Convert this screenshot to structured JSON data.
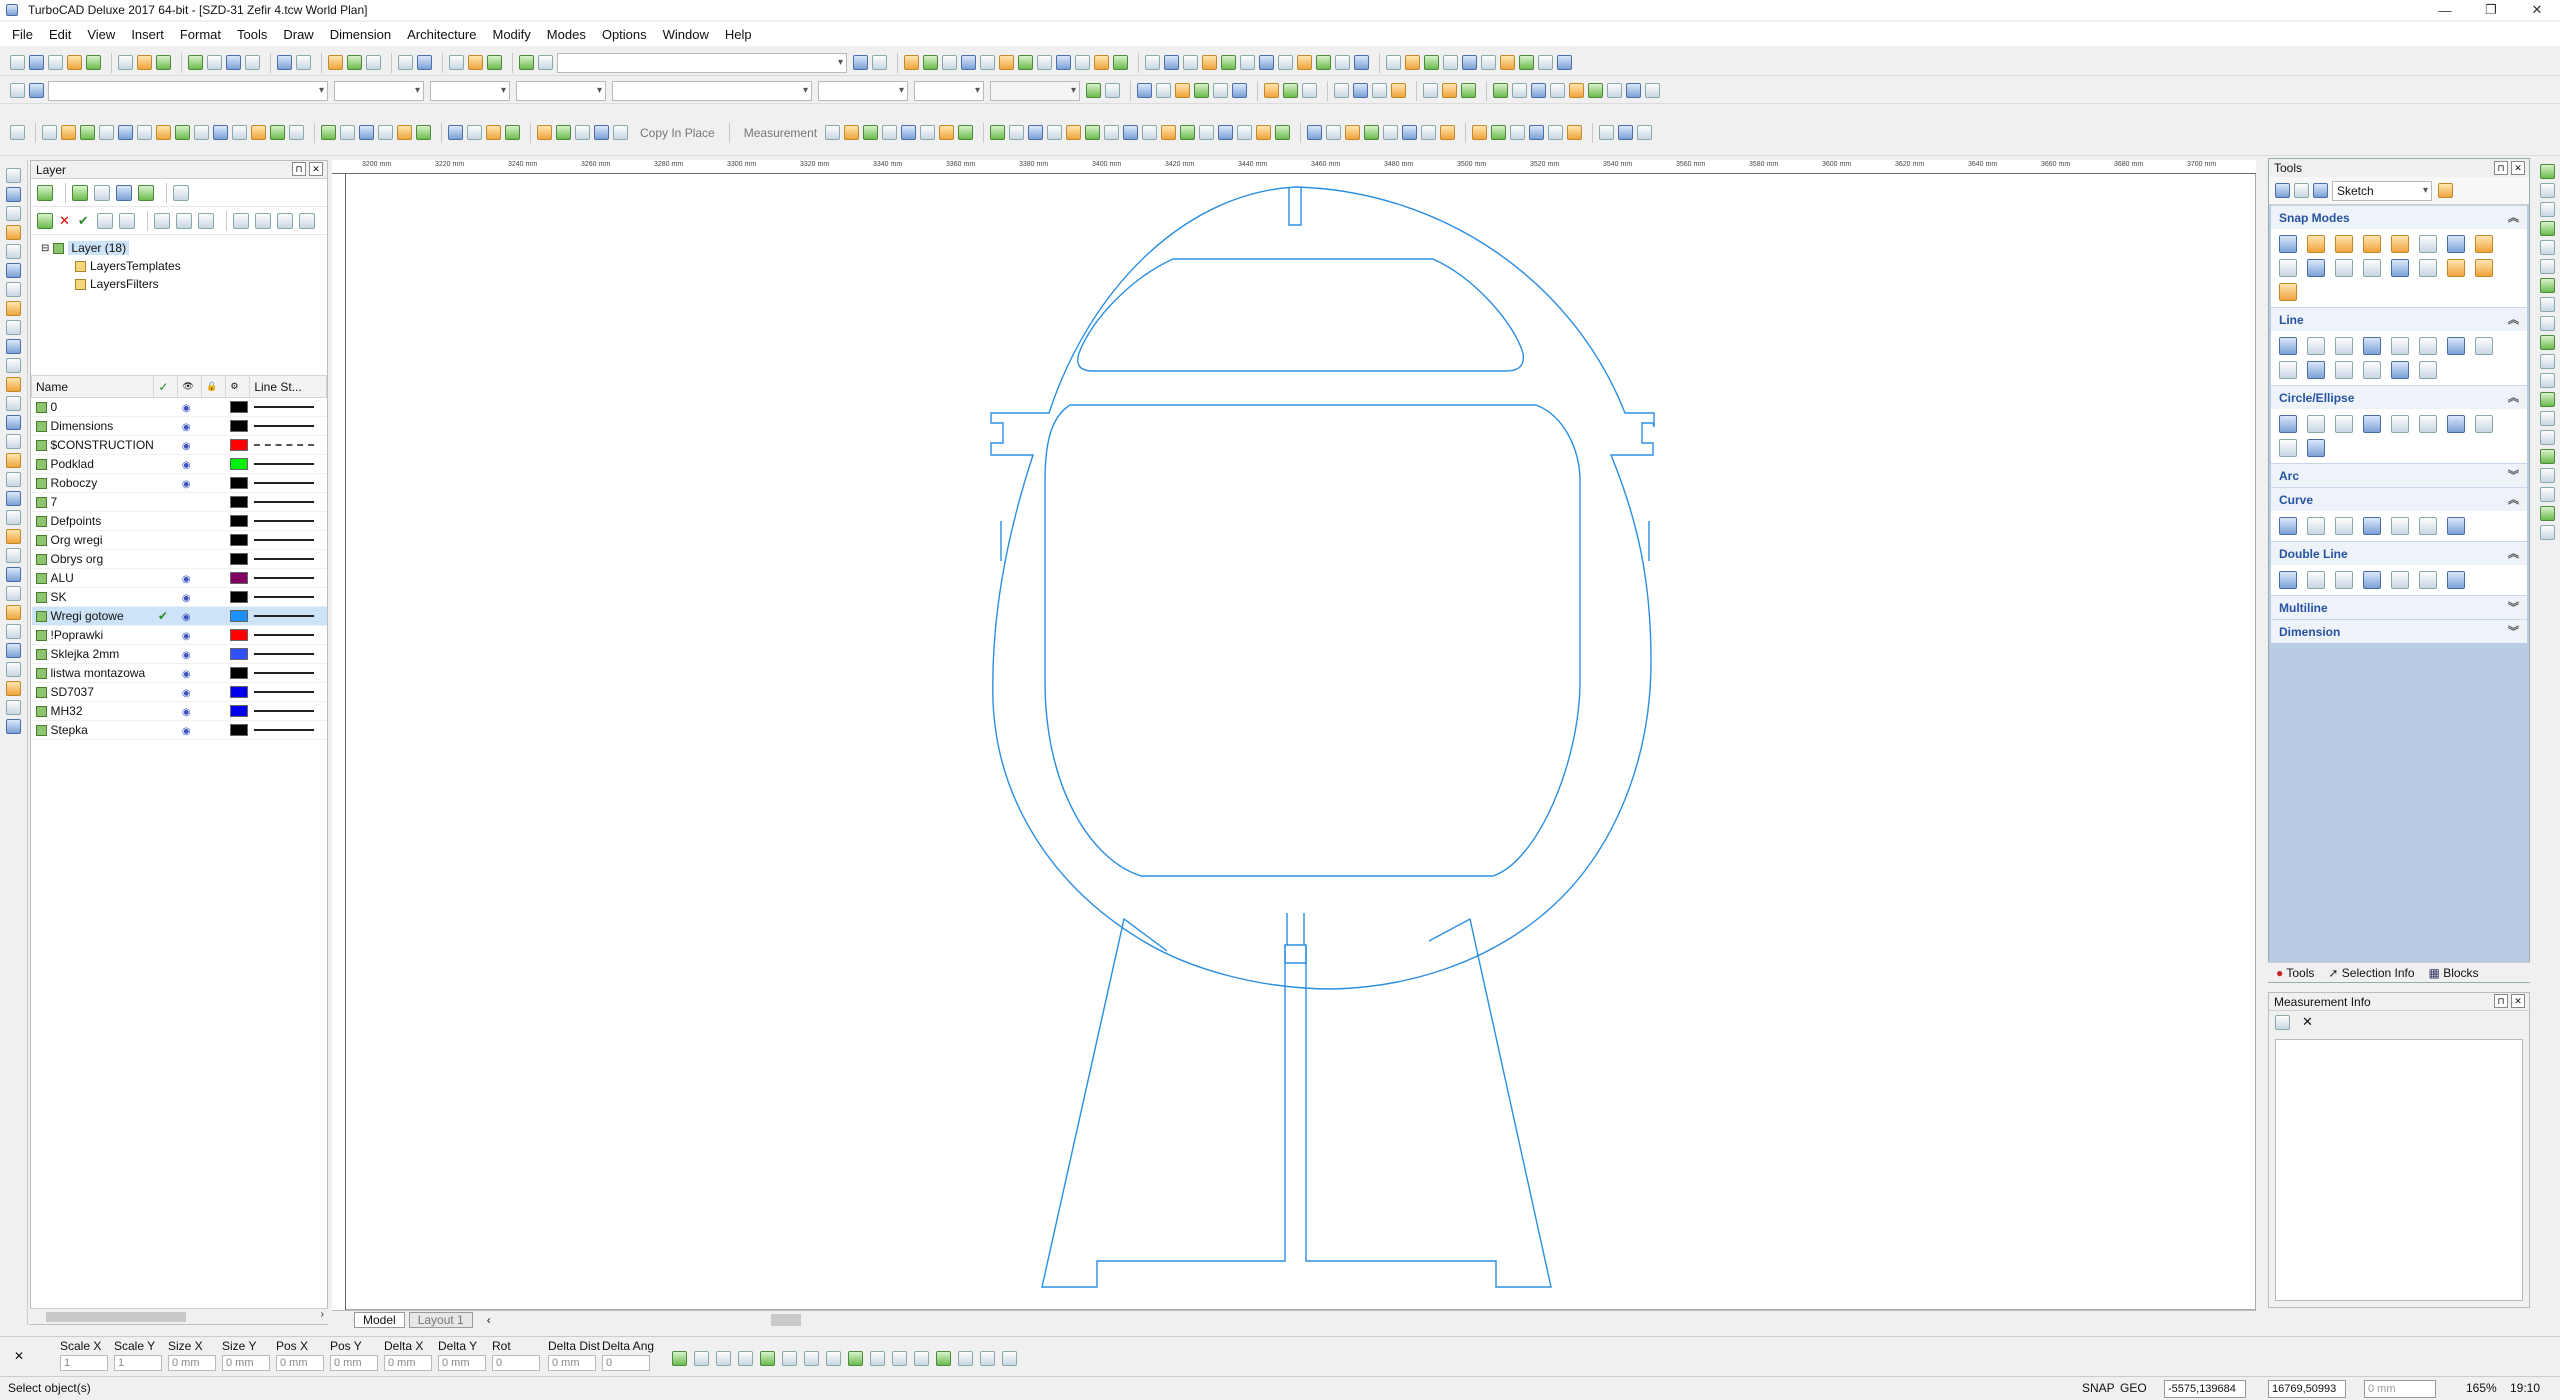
{
  "window": {
    "title": "TurboCAD Deluxe 2017 64-bit - [SZD-31 Zefir 4.tcw World Plan]",
    "minimize": "—",
    "restore": "❐",
    "close": "✕"
  },
  "menu": [
    "File",
    "Edit",
    "View",
    "Insert",
    "Format",
    "Tools",
    "Draw",
    "Dimension",
    "Architecture",
    "Modify",
    "Modes",
    "Options",
    "Window",
    "Help"
  ],
  "toolbar": {
    "copy_in_place": "Copy In Place",
    "measurement": "Measurement"
  },
  "layer_panel": {
    "title": "Layer",
    "tree": {
      "root": "Layer (18)",
      "children": [
        "LayersTemplates",
        "LayersFilters"
      ]
    },
    "columns": [
      "Name",
      "✓",
      "👁",
      "🔒",
      "⚙",
      "Line St..."
    ],
    "rows": [
      {
        "name": "0",
        "visible": true,
        "color": "#000000",
        "style": "solid"
      },
      {
        "name": "Dimensions",
        "visible": true,
        "color": "#000000",
        "style": "solid"
      },
      {
        "name": "$CONSTRUCTION",
        "visible": true,
        "color": "#ff0000",
        "style": "dash"
      },
      {
        "name": "Podklad",
        "visible": true,
        "color": "#00ee00",
        "style": "solid"
      },
      {
        "name": "Roboczy",
        "visible": true,
        "color": "#000000",
        "style": "solid"
      },
      {
        "name": "7",
        "visible": false,
        "color": "#000000",
        "style": "solid"
      },
      {
        "name": "Defpoints",
        "visible": false,
        "color": "#000000",
        "style": "solid"
      },
      {
        "name": "Org wregi",
        "visible": false,
        "color": "#000000",
        "style": "solid"
      },
      {
        "name": "Obrys org",
        "visible": false,
        "color": "#000000",
        "style": "solid"
      },
      {
        "name": "ALU",
        "visible": true,
        "color": "#800060",
        "style": "solid"
      },
      {
        "name": "SK",
        "visible": true,
        "color": "#000000",
        "style": "solid"
      },
      {
        "name": "Wregi gotowe",
        "visible": true,
        "color": "#1e90ff",
        "style": "solid",
        "active": true
      },
      {
        "name": "!Poprawki",
        "visible": true,
        "color": "#ff0000",
        "style": "solid"
      },
      {
        "name": "Sklejka 2mm",
        "visible": true,
        "color": "#3050ff",
        "style": "solid"
      },
      {
        "name": "listwa montazowa",
        "visible": true,
        "color": "#000000",
        "style": "solid"
      },
      {
        "name": "SD7037",
        "visible": true,
        "color": "#0000ee",
        "style": "solid"
      },
      {
        "name": "MH32",
        "visible": true,
        "color": "#0000ee",
        "style": "solid"
      },
      {
        "name": "Stepka",
        "visible": true,
        "color": "#000000",
        "style": "solid"
      }
    ]
  },
  "ruler": {
    "top_labels": [
      "3200 mm",
      "3220 mm",
      "3240 mm",
      "3260 mm",
      "3280 mm",
      "3300 mm",
      "3320 mm",
      "3340 mm",
      "3360 mm",
      "3380 mm",
      "3400 mm",
      "3420 mm",
      "3440 mm",
      "3460 mm",
      "3480 mm",
      "3500 mm",
      "3520 mm",
      "3540 mm",
      "3560 mm",
      "3580 mm",
      "3600 mm",
      "3620 mm",
      "3640 mm",
      "3660 mm",
      "3680 mm",
      "3700 mm"
    ]
  },
  "layout_tabs": [
    "Model",
    "Layout 1"
  ],
  "tools_panel": {
    "title": "Tools",
    "palette": "Sketch",
    "sections": [
      {
        "name": "Snap Modes",
        "expanded": true,
        "count": 17
      },
      {
        "name": "Line",
        "expanded": true,
        "count": 14
      },
      {
        "name": "Circle/Ellipse",
        "expanded": true,
        "count": 10
      },
      {
        "name": "Arc",
        "expanded": false,
        "count": 0
      },
      {
        "name": "Curve",
        "expanded": true,
        "count": 7
      },
      {
        "name": "Double Line",
        "expanded": true,
        "count": 7
      },
      {
        "name": "Multiline",
        "expanded": false,
        "count": 0
      },
      {
        "name": "Dimension",
        "expanded": false,
        "count": 0
      }
    ],
    "tabs": [
      "Tools",
      "Selection Info",
      "Blocks"
    ]
  },
  "measurement_info": {
    "title": "Measurement Info"
  },
  "inspector": {
    "fields": [
      "Scale X",
      "Scale Y",
      "Size X",
      "Size Y",
      "Pos X",
      "Pos Y",
      "Delta X",
      "Delta Y",
      "Rot",
      "Delta Dist",
      "Delta Ang"
    ],
    "values": [
      "1",
      "1",
      "0 mm",
      "0 mm",
      "0 mm",
      "0 mm",
      "0 mm",
      "0 mm",
      "0",
      "0 mm",
      "0"
    ]
  },
  "status": {
    "message": "Select object(s)",
    "snap": "SNAP",
    "geo": "GEO",
    "x": "-5575,139684",
    "y": "16769,50993",
    "mm": "0 mm",
    "zoom": "165%",
    "time": "19:10"
  },
  "colors": {
    "drawing_line": "#2a8ee0",
    "panel_bg": "#b8cce4",
    "section_title": "#2553a2"
  }
}
